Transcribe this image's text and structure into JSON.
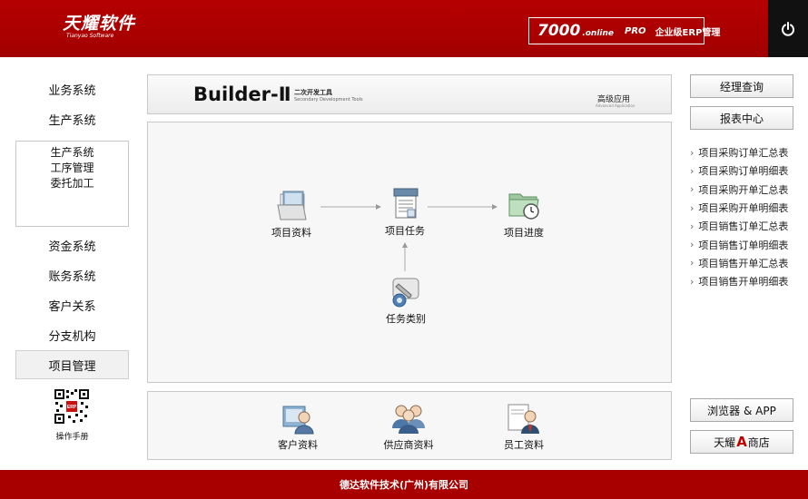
{
  "header": {
    "logo_main": "天耀软件",
    "logo_sub": "Tianyao Software",
    "erp_num": "7000",
    "erp_online": ".online",
    "erp_pro": "PRO",
    "erp_text": "企业级ERP管理",
    "power_icon": "power-icon"
  },
  "sidebar": {
    "items_top": [
      "业务系统",
      "生产系统"
    ],
    "submenu": [
      "生产系统",
      "工序管理",
      "委托加工"
    ],
    "items_bottom": [
      "资金系统",
      "账务系统",
      "客户关系",
      "分支机构"
    ],
    "active_item": "项目管理",
    "manual_label": "操作手册",
    "qr_icon": "qr-code-icon"
  },
  "banner": {
    "title": "Builder-Ⅱ",
    "subtitle_cn": "二次开发工具",
    "subtitle_en": "Secondary Development Tools",
    "advanced": "高级应用",
    "advanced_en": "Advanced Application"
  },
  "flow": {
    "project_info": "项目资料",
    "project_task": "项目任务",
    "project_progress": "项目进度",
    "task_category": "任务类别"
  },
  "bottom": {
    "customer": "客户资料",
    "supplier": "供应商资料",
    "employee": "员工资料"
  },
  "right": {
    "manager_query": "经理查询",
    "report_center": "报表中心",
    "reports": [
      "项目采购订单汇总表",
      "项目采购订单明细表",
      "项目采购开单汇总表",
      "项目采购开单明细表",
      "项目销售订单汇总表",
      "项目销售订单明细表",
      "项目销售开单汇总表",
      "项目销售开单明细表"
    ],
    "browser_app": "浏览器 & APP",
    "store_prefix": "天耀",
    "store_letter": "A",
    "store_suffix": "商店"
  },
  "footer": {
    "company": "德达软件技术(广州)有限公司"
  },
  "colors": {
    "brand_red": "#a80000",
    "power_bg": "#111111",
    "panel_bg": "#f7f7f7"
  }
}
